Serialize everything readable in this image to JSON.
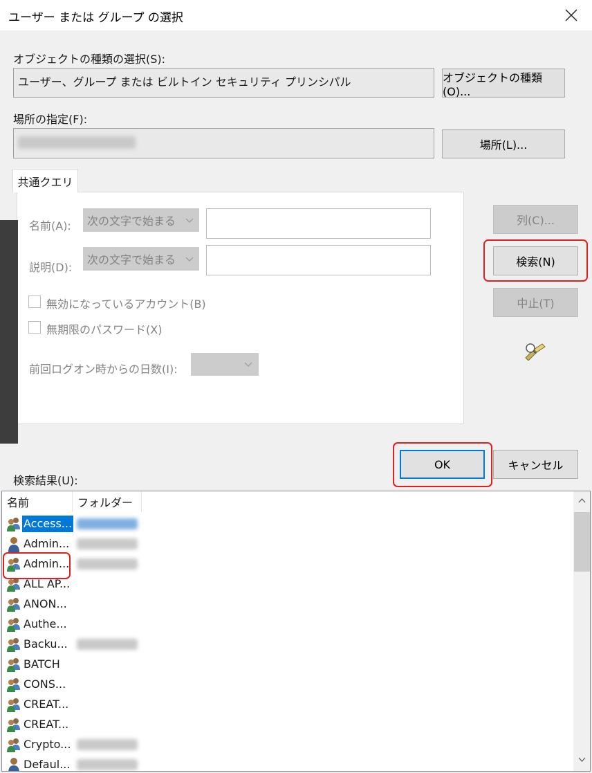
{
  "window": {
    "title": "ユーザー または グループ の選択"
  },
  "object_type": {
    "label": "オブジェクトの種類の選択(S):",
    "value": "ユーザー、グループ または ビルトイン セキュリティ プリンシパル",
    "button": "オブジェクトの種類(O)..."
  },
  "location": {
    "label": "場所の指定(F):",
    "value": "",
    "button": "場所(L)..."
  },
  "query": {
    "tab": "共通クエリ",
    "name_label": "名前(A):",
    "name_mode": "次の文字で始まる",
    "desc_label": "説明(D):",
    "desc_mode": "次の文字で始まる",
    "disabled_accounts": "無効になっているアカウント(B)",
    "non_expiring_pw": "無期限のパスワード(X)",
    "days_label": "前回ログオン時からの日数(I):"
  },
  "side_buttons": {
    "columns": "列(C)...",
    "search": "検索(N)",
    "stop": "中止(T)"
  },
  "dialog_buttons": {
    "ok": "OK",
    "cancel": "キャンセル"
  },
  "results": {
    "label": "検索結果(U):",
    "columns": [
      "名前",
      "フォルダー"
    ],
    "rows": [
      {
        "name": "Access...",
        "icon": "group-icon",
        "folder_blurred": true,
        "selected": true
      },
      {
        "name": "Admin...",
        "icon": "user-icon",
        "folder_blurred": true
      },
      {
        "name": "Admin...",
        "icon": "group-icon",
        "folder_blurred": true
      },
      {
        "name": "ALL AP...",
        "icon": "group-icon",
        "folder_blurred": false
      },
      {
        "name": "ANON...",
        "icon": "group-icon",
        "folder_blurred": false
      },
      {
        "name": "Authe...",
        "icon": "group-icon",
        "folder_blurred": false
      },
      {
        "name": "Backu...",
        "icon": "group-icon",
        "folder_blurred": true
      },
      {
        "name": "BATCH",
        "icon": "group-icon",
        "folder_blurred": false
      },
      {
        "name": "CONS...",
        "icon": "group-icon",
        "folder_blurred": false
      },
      {
        "name": "CREAT...",
        "icon": "group-icon",
        "folder_blurred": false
      },
      {
        "name": "CREAT...",
        "icon": "group-icon",
        "folder_blurred": false
      },
      {
        "name": "Crypto...",
        "icon": "group-icon",
        "folder_blurred": true
      },
      {
        "name": "Defaul...",
        "icon": "user-icon",
        "folder_blurred": true
      }
    ]
  },
  "colors": {
    "accent": "#0078d7",
    "highlight": "#e0201a",
    "disabled_text": "#838383"
  }
}
